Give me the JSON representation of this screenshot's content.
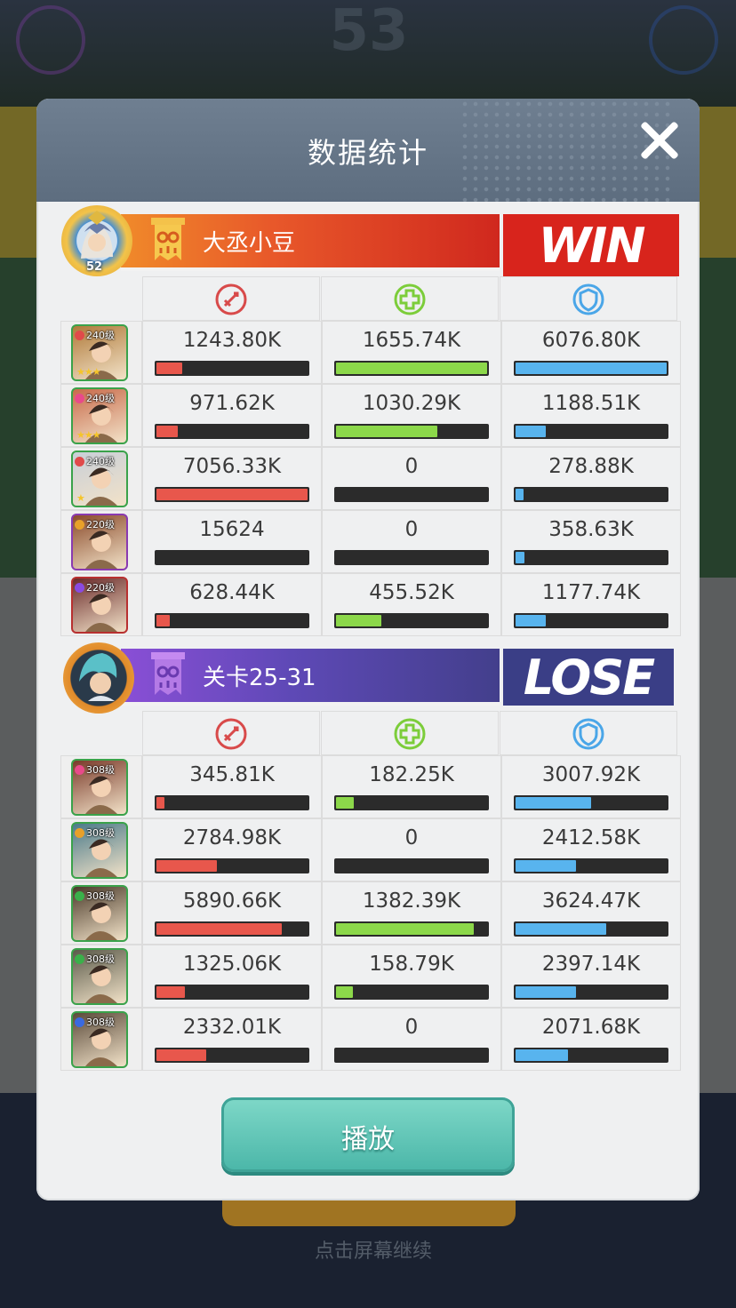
{
  "panel": {
    "title": "数据统计",
    "play_label": "播放"
  },
  "background": {
    "score": "53",
    "bottom_text": "点击屏幕继续"
  },
  "stat_icons": [
    "attack-icon",
    "heal-icon",
    "shield-icon"
  ],
  "colors": {
    "damage": "#e8574c",
    "heal": "#8cd84a",
    "tank": "#58b4ee",
    "win": "#d8241c",
    "lose": "#3a3e86"
  },
  "teams": [
    {
      "name": "大丞小豆",
      "result": "WIN",
      "avatar_level": "52",
      "heroes": [
        {
          "level": "240级",
          "stars": "★★★",
          "damage": "1243.80K",
          "damage_pct": 0.17,
          "heal": "1655.74K",
          "heal_pct": 1.0,
          "tank": "6076.80K",
          "tank_pct": 1.0
        },
        {
          "level": "240级",
          "stars": "★★★",
          "damage": "971.62K",
          "damage_pct": 0.14,
          "heal": "1030.29K",
          "heal_pct": 0.67,
          "tank": "1188.51K",
          "tank_pct": 0.2
        },
        {
          "level": "240级",
          "stars": "★",
          "damage": "7056.33K",
          "damage_pct": 1.0,
          "heal": "0",
          "heal_pct": 0.0,
          "tank": "278.88K",
          "tank_pct": 0.05
        },
        {
          "level": "220级",
          "stars": "",
          "damage": "15624",
          "damage_pct": 0.0,
          "heal": "0",
          "heal_pct": 0.0,
          "tank": "358.63K",
          "tank_pct": 0.06
        },
        {
          "level": "220级",
          "stars": "",
          "damage": "628.44K",
          "damage_pct": 0.09,
          "heal": "455.52K",
          "heal_pct": 0.3,
          "tank": "1177.74K",
          "tank_pct": 0.2
        }
      ]
    },
    {
      "name": "关卡25-31",
      "result": "LOSE",
      "heroes": [
        {
          "level": "308级",
          "damage": "345.81K",
          "damage_pct": 0.05,
          "heal": "182.25K",
          "heal_pct": 0.12,
          "tank": "3007.92K",
          "tank_pct": 0.5
        },
        {
          "level": "308级",
          "damage": "2784.98K",
          "damage_pct": 0.4,
          "heal": "0",
          "heal_pct": 0.0,
          "tank": "2412.58K",
          "tank_pct": 0.4
        },
        {
          "level": "308级",
          "damage": "5890.66K",
          "damage_pct": 0.83,
          "heal": "1382.39K",
          "heal_pct": 0.91,
          "tank": "3624.47K",
          "tank_pct": 0.6
        },
        {
          "level": "308级",
          "damage": "1325.06K",
          "damage_pct": 0.19,
          "heal": "158.79K",
          "heal_pct": 0.11,
          "tank": "2397.14K",
          "tank_pct": 0.4
        },
        {
          "level": "308级",
          "damage": "2332.01K",
          "damage_pct": 0.33,
          "heal": "0",
          "heal_pct": 0.0,
          "tank": "2071.68K",
          "tank_pct": 0.35
        }
      ]
    }
  ]
}
